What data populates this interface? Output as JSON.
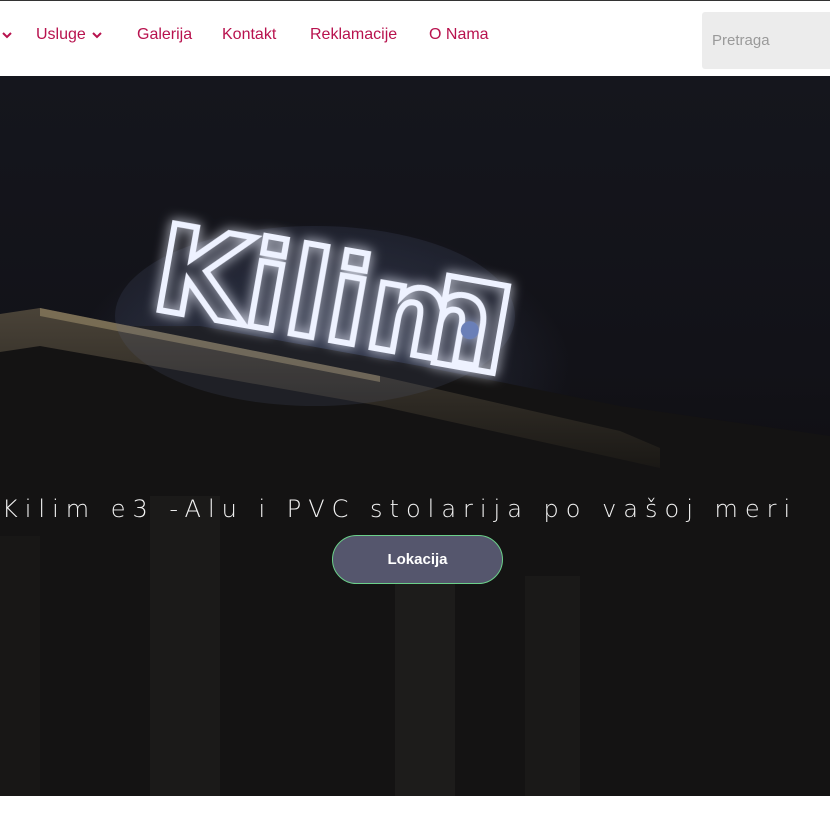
{
  "nav": {
    "items": [
      {
        "label": "Usluge",
        "has_dropdown": true
      },
      {
        "label": "Galerija",
        "has_dropdown": false
      },
      {
        "label": "Kontakt",
        "has_dropdown": false
      },
      {
        "label": "Reklamacije",
        "has_dropdown": false
      },
      {
        "label": "O Nama",
        "has_dropdown": false
      }
    ],
    "color": "#b8124e"
  },
  "search": {
    "placeholder": "Pretraga"
  },
  "hero": {
    "sign_text": "Kilim",
    "tagline": "Kilim e3 -Alu i PVC stolarija po vašoj meri",
    "button_label": "Lokacija",
    "button_color": "#55566d",
    "button_border_color": "#6bd08a"
  }
}
